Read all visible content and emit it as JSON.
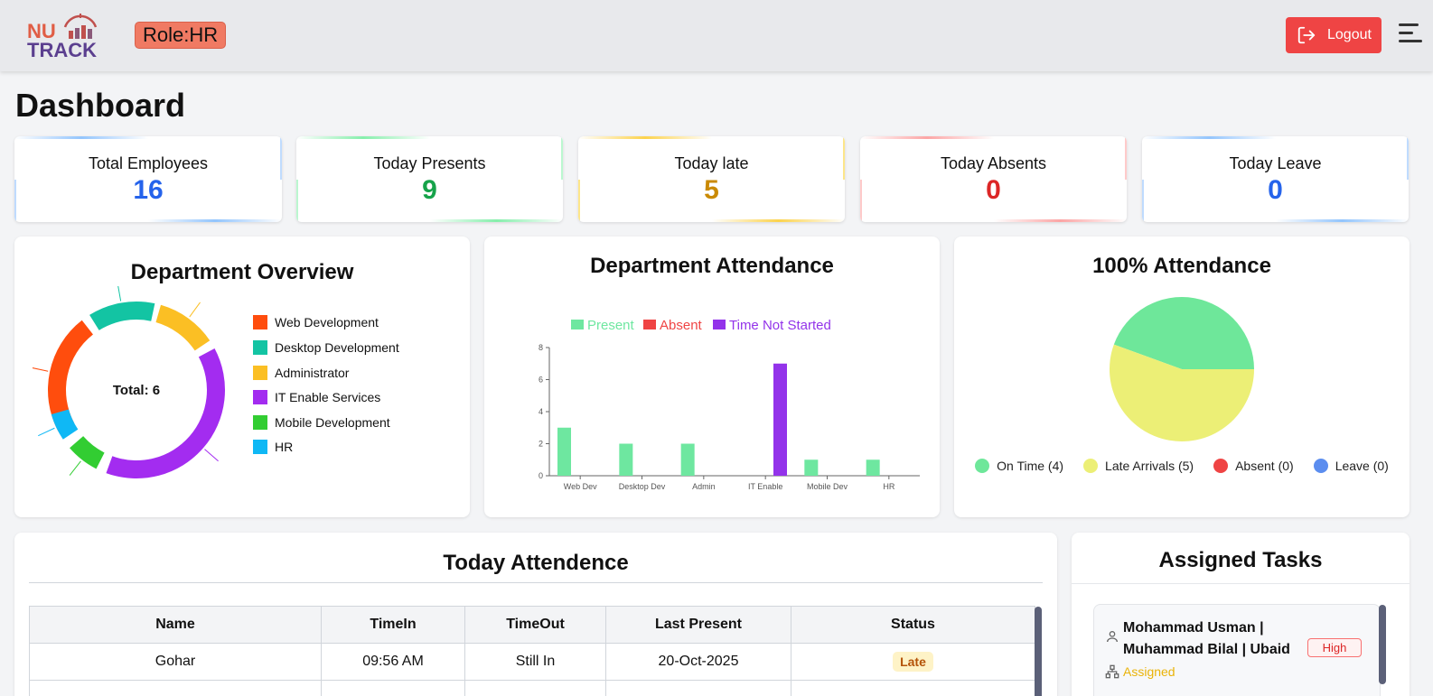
{
  "header": {
    "logo_line1": "NU",
    "logo_line2": "TRACK",
    "role": "Role:HR",
    "logout_label": "Logout"
  },
  "page_title": "Dashboard",
  "stats": [
    {
      "label": "Total Employees",
      "value": "16",
      "color": "#2563eb"
    },
    {
      "label": "Today Presents",
      "value": "9",
      "color": "#16a34a"
    },
    {
      "label": "Today late",
      "value": "5",
      "color": "#ca8a04"
    },
    {
      "label": "Today Absents",
      "value": "0",
      "color": "#dc2626"
    },
    {
      "label": "Today Leave",
      "value": "0",
      "color": "#2563eb"
    }
  ],
  "department_overview": {
    "title": "Department Overview",
    "center_label": "Total: 6",
    "legend": [
      {
        "label": "Web Development",
        "color": "#ff4d0d"
      },
      {
        "label": "Desktop Development",
        "color": "#13c4a3"
      },
      {
        "label": "Administrator",
        "color": "#fbbf24"
      },
      {
        "label": "IT Enable Services",
        "color": "#a32cf0"
      },
      {
        "label": "Mobile Development",
        "color": "#32cd32"
      },
      {
        "label": "HR",
        "color": "#0fb8f5"
      }
    ]
  },
  "chart_data": [
    {
      "type": "bar",
      "title": "Department Attendance",
      "categories": [
        "Web Dev",
        "Desktop Dev",
        "Admin",
        "IT Enable",
        "Mobile Dev",
        "HR"
      ],
      "series": [
        {
          "name": "Present",
          "color": "#6ee7a0",
          "values": [
            3,
            2,
            2,
            0,
            1,
            1
          ]
        },
        {
          "name": "Absent",
          "color": "#ef4444",
          "values": [
            0,
            0,
            0,
            0,
            0,
            0
          ]
        },
        {
          "name": "Time Not Started",
          "color": "#9333ea",
          "values": [
            0,
            0,
            0,
            7,
            0,
            0
          ]
        }
      ],
      "yticks": [
        "0",
        "2",
        "4",
        "6",
        "8"
      ],
      "ylim": [
        0,
        8
      ],
      "legend": "top"
    },
    {
      "type": "pie",
      "title": "100% Attendance",
      "labels": [
        "On Time (4)",
        "Late Arrivals (5)",
        "Absent (0)",
        "Leave (0)"
      ],
      "values": [
        4,
        5,
        0,
        0
      ],
      "colors": [
        "#6ee79a",
        "#ecef76",
        "#ef4444",
        "#5b8def"
      ],
      "legend": "bottom"
    }
  ],
  "today_attendance": {
    "title": "Today Attendence",
    "columns": [
      "Name",
      "TimeIn",
      "TimeOut",
      "Last Present",
      "Status"
    ],
    "rows": [
      {
        "name": "Gohar",
        "time_in": "09:56 AM",
        "time_out": "Still In",
        "last_present": "20-Oct-2025",
        "status": "Late"
      }
    ]
  },
  "assigned_tasks": {
    "title": "Assigned Tasks",
    "tasks": [
      {
        "assignees": "Mohammad Usman | Muhammad Bilal | Ubaid",
        "priority": "High",
        "status": "Assigned"
      }
    ]
  }
}
